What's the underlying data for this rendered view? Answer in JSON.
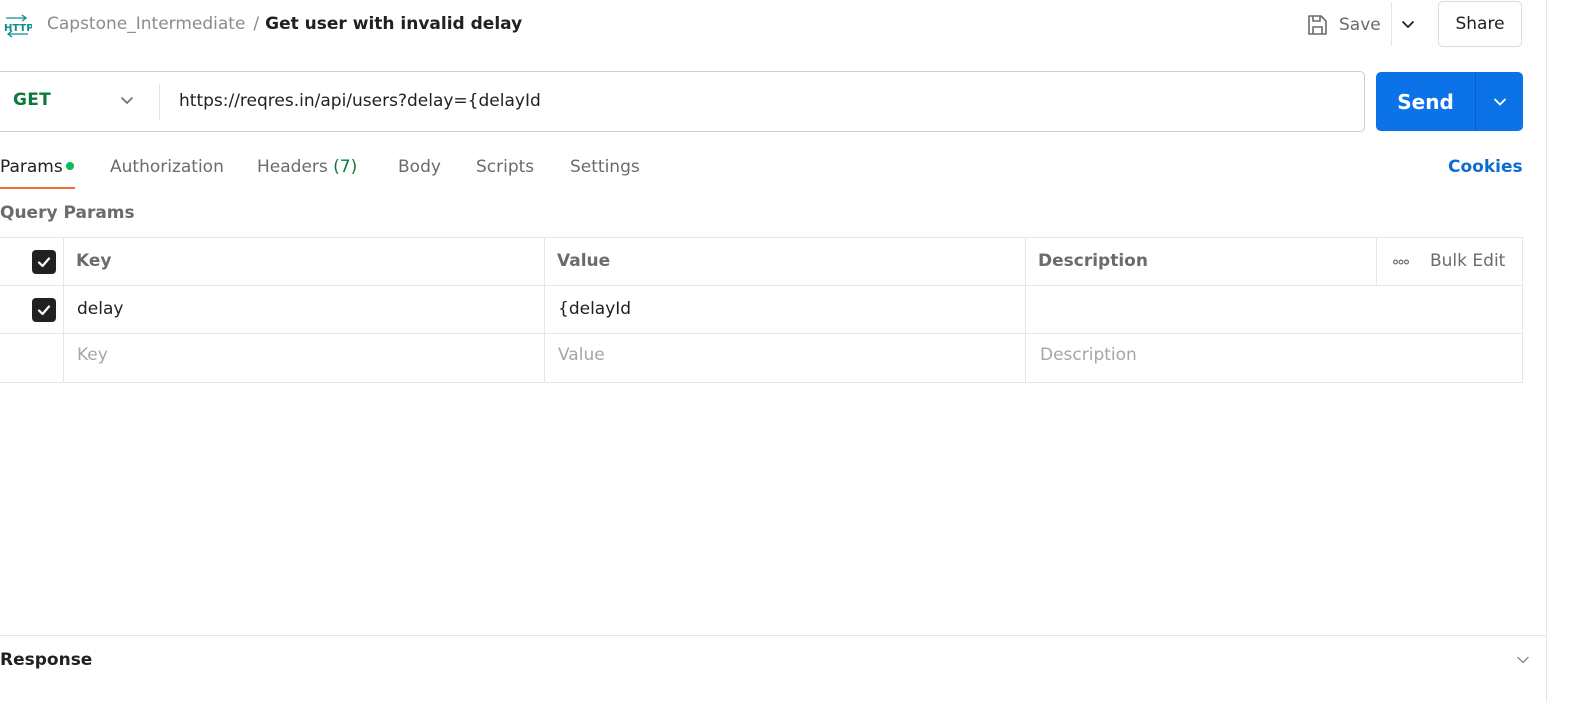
{
  "header": {
    "icon": "http-icon",
    "collection": "Capstone_Intermediate",
    "separator": "/",
    "request_name": "Get user with invalid delay",
    "save_label": "Save",
    "share_label": "Share"
  },
  "request": {
    "method": "GET",
    "url": "https://reqres.in/api/users?delay={delayId",
    "send_label": "Send"
  },
  "tabs": {
    "params": "Params",
    "authorization": "Authorization",
    "headers": "Headers",
    "headers_count": "(7)",
    "body": "Body",
    "scripts": "Scripts",
    "settings": "Settings",
    "cookies": "Cookies"
  },
  "query_params": {
    "title": "Query Params",
    "columns": {
      "key": "Key",
      "value": "Value",
      "description": "Description",
      "bulk_edit": "Bulk Edit"
    },
    "rows": [
      {
        "checked": true,
        "key": "delay",
        "value": "{delayId",
        "description": ""
      }
    ],
    "placeholders": {
      "key": "Key",
      "value": "Value",
      "description": "Description"
    }
  },
  "response": {
    "title": "Response"
  },
  "colors": {
    "send": "#0c72e8",
    "method_get": "#0b7a3b",
    "active_tab_underline": "#f26b3a",
    "cookies_link": "#0c6dd1",
    "params_dot": "#0cbb52"
  }
}
